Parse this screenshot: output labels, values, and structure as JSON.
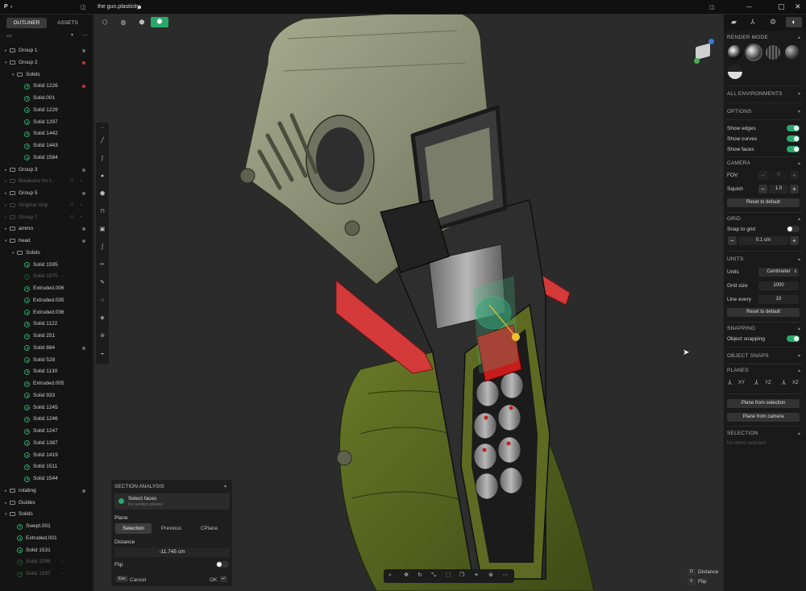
{
  "app": {
    "menu": "P",
    "doc_title": "the gun.plasticity"
  },
  "sidebar": {
    "tabs": [
      "OUTLINER",
      "ASSETS"
    ],
    "items": [
      {
        "label": "Group 1",
        "kind": "group",
        "level": 0,
        "dot": "gray"
      },
      {
        "label": "Group 2",
        "kind": "group",
        "level": 0,
        "dot": "red"
      },
      {
        "label": "Solids",
        "kind": "folder",
        "level": 1
      },
      {
        "label": "Solid 1226",
        "kind": "solid",
        "level": 2,
        "dot": "red"
      },
      {
        "label": "Solid.001",
        "kind": "solid",
        "level": 2
      },
      {
        "label": "Solid 1229",
        "kind": "solid",
        "level": 2
      },
      {
        "label": "Solid 1297",
        "kind": "solid",
        "level": 2
      },
      {
        "label": "Solid 1442",
        "kind": "solid",
        "level": 2
      },
      {
        "label": "Solid 1443",
        "kind": "solid",
        "level": 2
      },
      {
        "label": "Solid 1584",
        "kind": "solid",
        "level": 2
      },
      {
        "label": "Group 3",
        "kind": "group",
        "level": 0,
        "dot": "gray"
      },
      {
        "label": "Booleans for t...",
        "kind": "group",
        "level": 0,
        "dim": true,
        "locked": true
      },
      {
        "label": "Group 5",
        "kind": "group",
        "level": 0,
        "dot": "gray"
      },
      {
        "label": "Original Grip",
        "kind": "group",
        "level": 0,
        "dim": true,
        "locked": true
      },
      {
        "label": "Group 7",
        "kind": "group",
        "level": 0,
        "dim": true,
        "locked": true
      },
      {
        "label": "ammo",
        "kind": "group",
        "level": 0,
        "dot": "gray"
      },
      {
        "label": "head",
        "kind": "group",
        "level": 0,
        "dot": "gray"
      },
      {
        "label": "Solids",
        "kind": "folder",
        "level": 1
      },
      {
        "label": "Solid 1595",
        "kind": "solid",
        "level": 2
      },
      {
        "label": "Solid 1575",
        "kind": "solid",
        "level": 2,
        "dim": true,
        "hidden": true
      },
      {
        "label": "Extruded.006",
        "kind": "solid",
        "level": 2
      },
      {
        "label": "Extruded.035",
        "kind": "solid",
        "level": 2
      },
      {
        "label": "Extruded.036",
        "kind": "solid",
        "level": 2
      },
      {
        "label": "Solid 1122",
        "kind": "solid",
        "level": 2
      },
      {
        "label": "Solid 251",
        "kind": "solid",
        "level": 2
      },
      {
        "label": "Solid 884",
        "kind": "solid",
        "level": 2,
        "dot": "gray"
      },
      {
        "label": "Solid 528",
        "kind": "solid",
        "level": 2
      },
      {
        "label": "Solid 1130",
        "kind": "solid",
        "level": 2
      },
      {
        "label": "Extruded.005",
        "kind": "solid",
        "level": 2
      },
      {
        "label": "Solid 933",
        "kind": "solid",
        "level": 2
      },
      {
        "label": "Solid 1245",
        "kind": "solid",
        "level": 2
      },
      {
        "label": "Solid 1246",
        "kind": "solid",
        "level": 2
      },
      {
        "label": "Solid 1247",
        "kind": "solid",
        "level": 2
      },
      {
        "label": "Solid 1387",
        "kind": "solid",
        "level": 2
      },
      {
        "label": "Solid 1419",
        "kind": "solid",
        "level": 2
      },
      {
        "label": "Solid 1511",
        "kind": "solid",
        "level": 2
      },
      {
        "label": "Solid 1544",
        "kind": "solid",
        "level": 2
      },
      {
        "label": "rotating",
        "kind": "group",
        "level": 0,
        "dot": "gray"
      },
      {
        "label": "Guides",
        "kind": "group",
        "level": 0
      },
      {
        "label": "Solids",
        "kind": "folder",
        "level": 0
      },
      {
        "label": "Swept.001",
        "kind": "solid",
        "level": 1
      },
      {
        "label": "Extruded.001",
        "kind": "solid",
        "level": 1
      },
      {
        "label": "Solid 1531",
        "kind": "solid",
        "level": 1
      },
      {
        "label": "Solid 1596",
        "kind": "solid",
        "level": 1,
        "dim": true,
        "hidden": true
      },
      {
        "label": "Solid 1597",
        "kind": "solid",
        "level": 1,
        "dim": true,
        "hidden": true
      }
    ]
  },
  "section_analysis": {
    "title": "SECTION ANALYSIS",
    "select_faces": "Select faces",
    "select_hint": "for section planes",
    "plane_label": "Plane",
    "plane_options": [
      "Selection",
      "Previous",
      "CPlane"
    ],
    "plane_selected": "Selection",
    "distance_label": "Distance",
    "distance_value": "-11.745 cm",
    "flip_label": "Flip",
    "flip_on": false,
    "esc_key": "Esc",
    "cancel_label": "Cancel",
    "ok_label": "OK"
  },
  "hints": [
    {
      "key": "D",
      "label": "Distance"
    },
    {
      "key": "F",
      "label": "Flip"
    }
  ],
  "right_panel": {
    "render_mode": {
      "title": "RENDER MODE"
    },
    "environments_title": "ALL ENVIRONMENTS",
    "options": {
      "title": "OPTIONS",
      "show_edges": {
        "label": "Show edges",
        "on": true
      },
      "show_curves": {
        "label": "Show curves",
        "on": true
      },
      "show_faces": {
        "label": "Show faces",
        "on": true
      }
    },
    "camera": {
      "title": "CAMERA",
      "fov_label": "FOV",
      "fov_value": "0",
      "squish_label": "Squish",
      "squish_value": "1.0",
      "reset": "Reset to default"
    },
    "grid": {
      "title": "GRID",
      "snap_label": "Snap to grid",
      "snap_on": false,
      "size_value": "0.1 cm"
    },
    "units": {
      "title": "UNITS",
      "units_label": "Units",
      "units_value": "Centimeter",
      "grid_size_label": "Grid size",
      "grid_size_value": "1000",
      "line_every_label": "Line every",
      "line_every_value": "10",
      "reset": "Reset to default"
    },
    "snapping": {
      "title": "SNAPPING",
      "object_label": "Object snapping",
      "object_on": true
    },
    "object_snaps_title": "OBJECT SNAPS",
    "planes": {
      "title": "PLANES",
      "xy": "XY",
      "yz": "YZ",
      "xz": "XZ",
      "from_selection": "Plane from selection",
      "from_camera": "Plane from camera"
    },
    "selection": {
      "title": "SELECTION",
      "empty": "No items selected"
    }
  },
  "colors": {
    "accent": "#2aa86b",
    "warning": "#c0392b",
    "olive": "#5a6b1f",
    "hull": "#8a8f74"
  }
}
